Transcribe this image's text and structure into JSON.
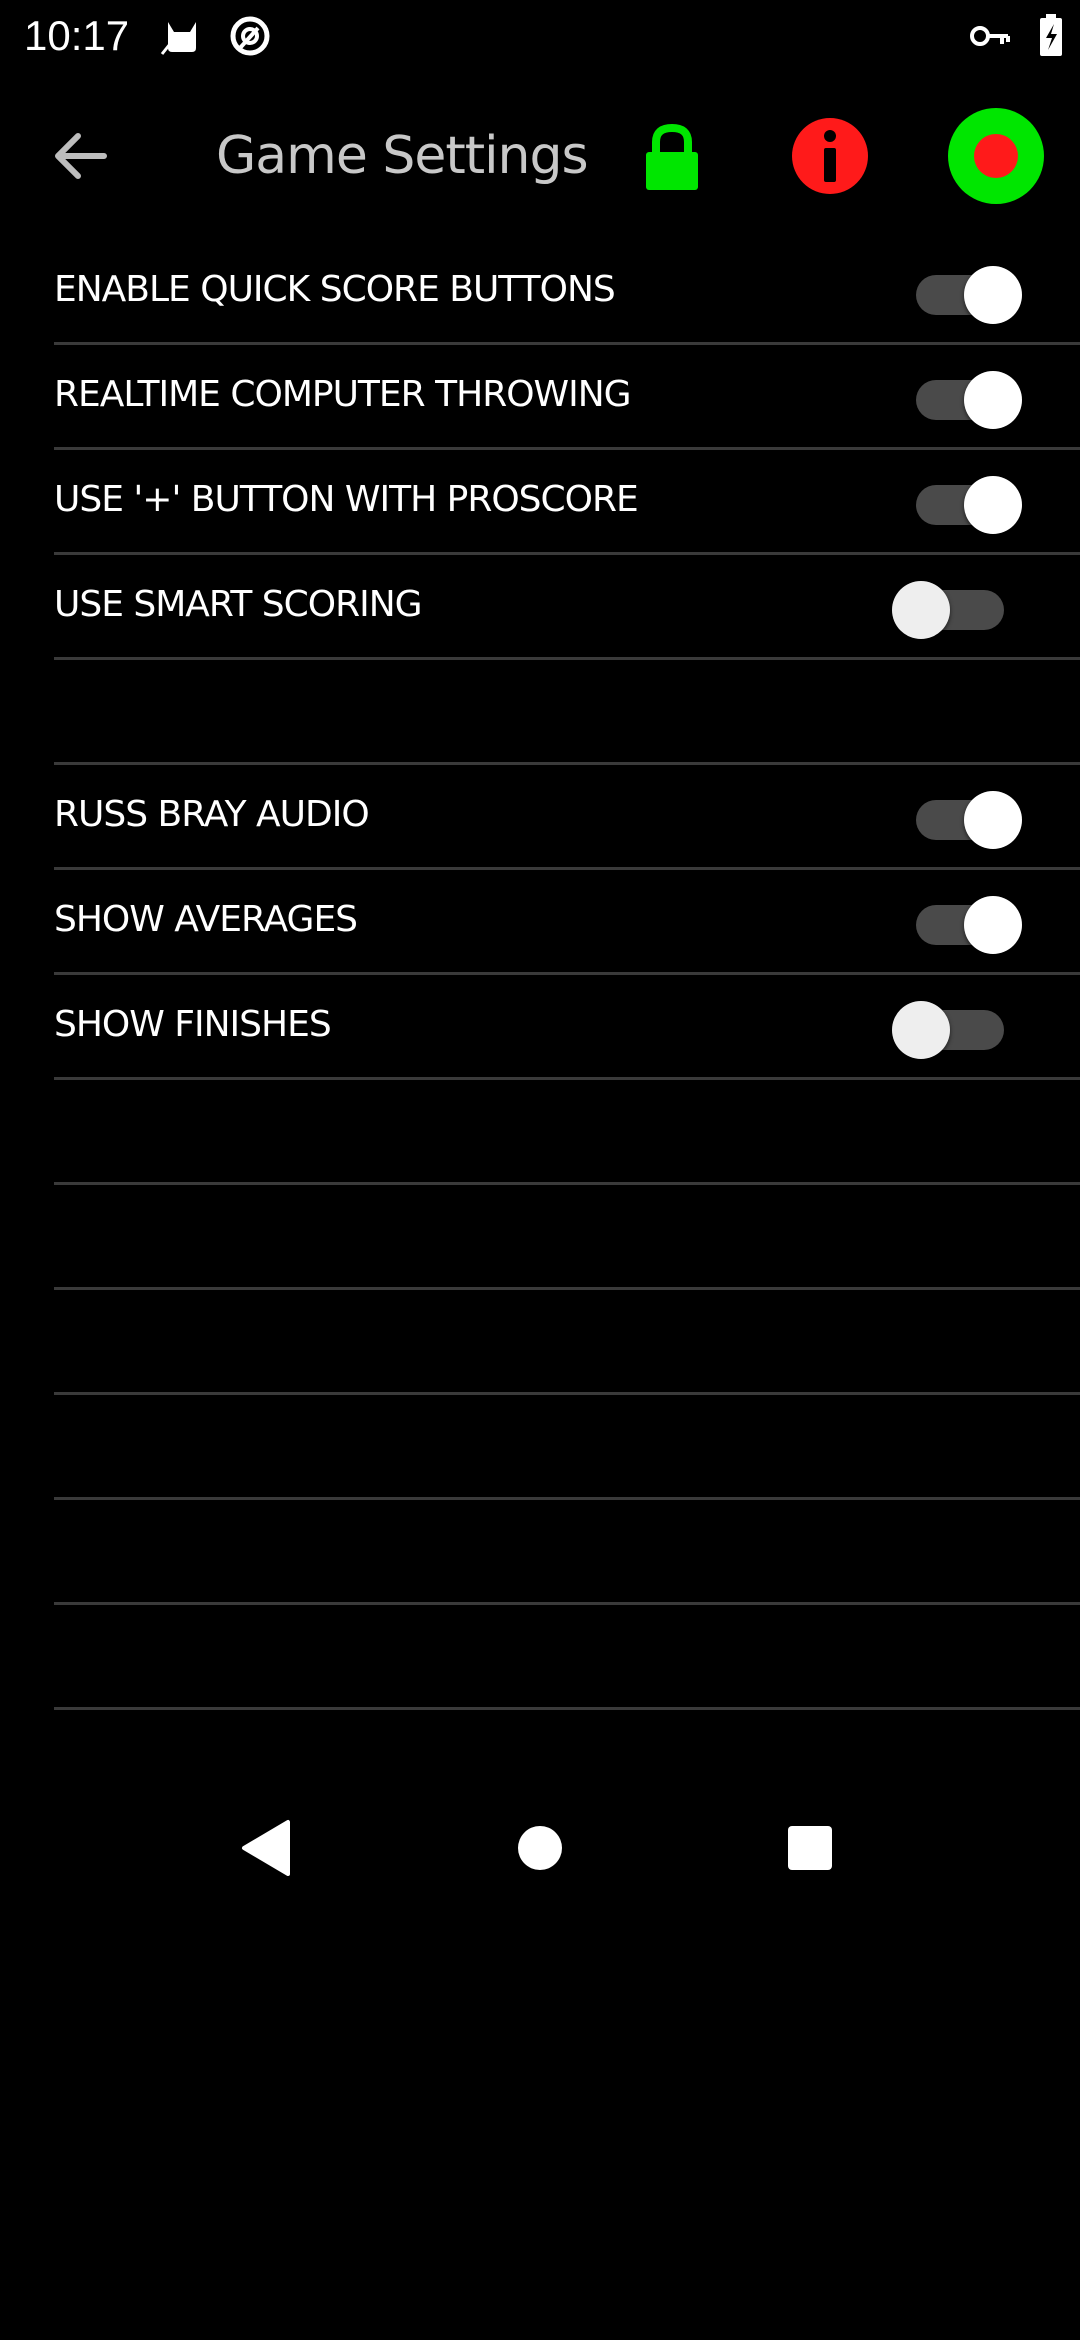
{
  "status_bar": {
    "time": "10:17",
    "left_icons": [
      "cat-icon",
      "notification-app-icon"
    ],
    "right_icons": [
      "vpn-key-icon",
      "battery-charging-icon"
    ]
  },
  "toolbar": {
    "title": "Game Settings",
    "back_icon": "arrow-left-icon",
    "lock_icon": "lock-icon",
    "info_icon": "info-icon",
    "record_icon": "record-icon",
    "colors": {
      "lock": "#00e600",
      "info": "#ff1a1a",
      "record_outer": "#00e600",
      "record_inner": "#ff1a1a",
      "title": "#c8c8c8"
    }
  },
  "settings": [
    {
      "label": "ENABLE QUICK SCORE BUTTONS",
      "enabled": true
    },
    {
      "label": "REALTIME COMPUTER THROWING",
      "enabled": true
    },
    {
      "label": "USE '+' BUTTON WITH PROSCORE",
      "enabled": true
    },
    {
      "label": "USE SMART SCORING",
      "enabled": false
    },
    {
      "label": "",
      "enabled": null
    },
    {
      "label": "RUSS BRAY AUDIO",
      "enabled": true
    },
    {
      "label": "SHOW AVERAGES",
      "enabled": true
    },
    {
      "label": "SHOW FINISHES",
      "enabled": false
    },
    {
      "label": "",
      "enabled": null
    },
    {
      "label": "",
      "enabled": null
    },
    {
      "label": "",
      "enabled": null
    },
    {
      "label": "",
      "enabled": null
    },
    {
      "label": "",
      "enabled": null
    },
    {
      "label": "",
      "enabled": null
    }
  ],
  "nav_bar": {
    "back_icon": "nav-back-triangle-icon",
    "home_icon": "nav-home-circle-icon",
    "recents_icon": "nav-recents-square-icon"
  }
}
